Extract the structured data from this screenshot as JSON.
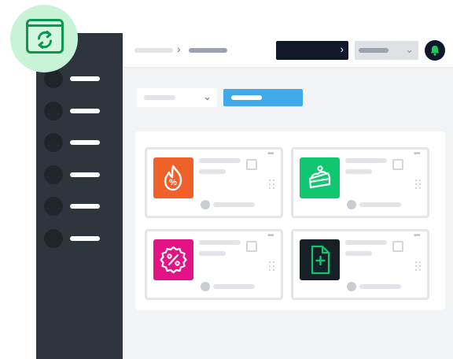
{
  "app_badge": {
    "icon": "refresh-window-icon",
    "color": "#0e9550",
    "bg": "#c9f3d6"
  },
  "sidebar": {
    "items": [
      {
        "icon": "circle-placeholder"
      },
      {
        "icon": "circle-placeholder"
      },
      {
        "icon": "circle-placeholder"
      },
      {
        "icon": "circle-placeholder"
      },
      {
        "icon": "circle-placeholder"
      },
      {
        "icon": "circle-placeholder"
      }
    ]
  },
  "topbar": {
    "breadcrumb_separator": "›",
    "dark_dropdown_chevron": "›",
    "grey_dropdown_chevron": "⌄",
    "bell_color": "#22c55e"
  },
  "toolbar": {
    "filter_chevron": "⌄",
    "primary_button_color": "#3fa9ea"
  },
  "cards": [
    {
      "icon": "percent-flame-icon",
      "tile_color": "#f0612a",
      "more": "•••"
    },
    {
      "icon": "cake-slice-icon",
      "tile_color": "#10c66f",
      "more": "•••"
    },
    {
      "icon": "discount-badge-icon",
      "tile_color": "#e21485",
      "more": "•••"
    },
    {
      "icon": "add-document-icon",
      "tile_color": "#172027",
      "more": "•••"
    }
  ]
}
